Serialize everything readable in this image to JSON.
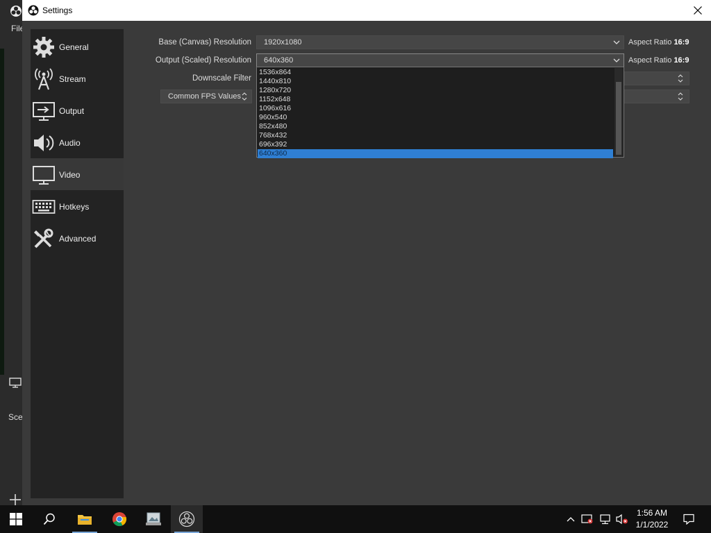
{
  "background_app": {
    "menu_file": "File",
    "scenes_label": "Scen"
  },
  "window": {
    "title": "Settings"
  },
  "sidebar": {
    "items": [
      {
        "label": "General",
        "icon": "gear-icon"
      },
      {
        "label": "Stream",
        "icon": "antenna-icon"
      },
      {
        "label": "Output",
        "icon": "output-monitor-icon"
      },
      {
        "label": "Audio",
        "icon": "speaker-icon"
      },
      {
        "label": "Video",
        "icon": "monitor-icon",
        "active": true
      },
      {
        "label": "Hotkeys",
        "icon": "keyboard-icon"
      },
      {
        "label": "Advanced",
        "icon": "tools-icon"
      }
    ]
  },
  "video": {
    "base_label": "Base (Canvas) Resolution",
    "base_value": "1920x1080",
    "base_aspect_prefix": "Aspect Ratio",
    "base_aspect_value": "16:9",
    "output_label": "Output (Scaled) Resolution",
    "output_value": "640x360",
    "output_aspect_prefix": "Aspect Ratio",
    "output_aspect_value": "16:9",
    "downscale_label": "Downscale Filter",
    "fps_type_value": "Common FPS Values"
  },
  "dropdown": {
    "options": [
      "1536x864",
      "1440x810",
      "1280x720",
      "1152x648",
      "1096x616",
      "960x540",
      "852x480",
      "768x432",
      "696x392",
      "640x360"
    ],
    "selected": "640x360"
  },
  "taskbar": {
    "time": "1:56 AM",
    "date": "1/1/2022"
  },
  "colors": {
    "selection": "#2f7fd3",
    "dialog_bg": "#3a3a3a",
    "sidebar_bg": "#232323"
  }
}
